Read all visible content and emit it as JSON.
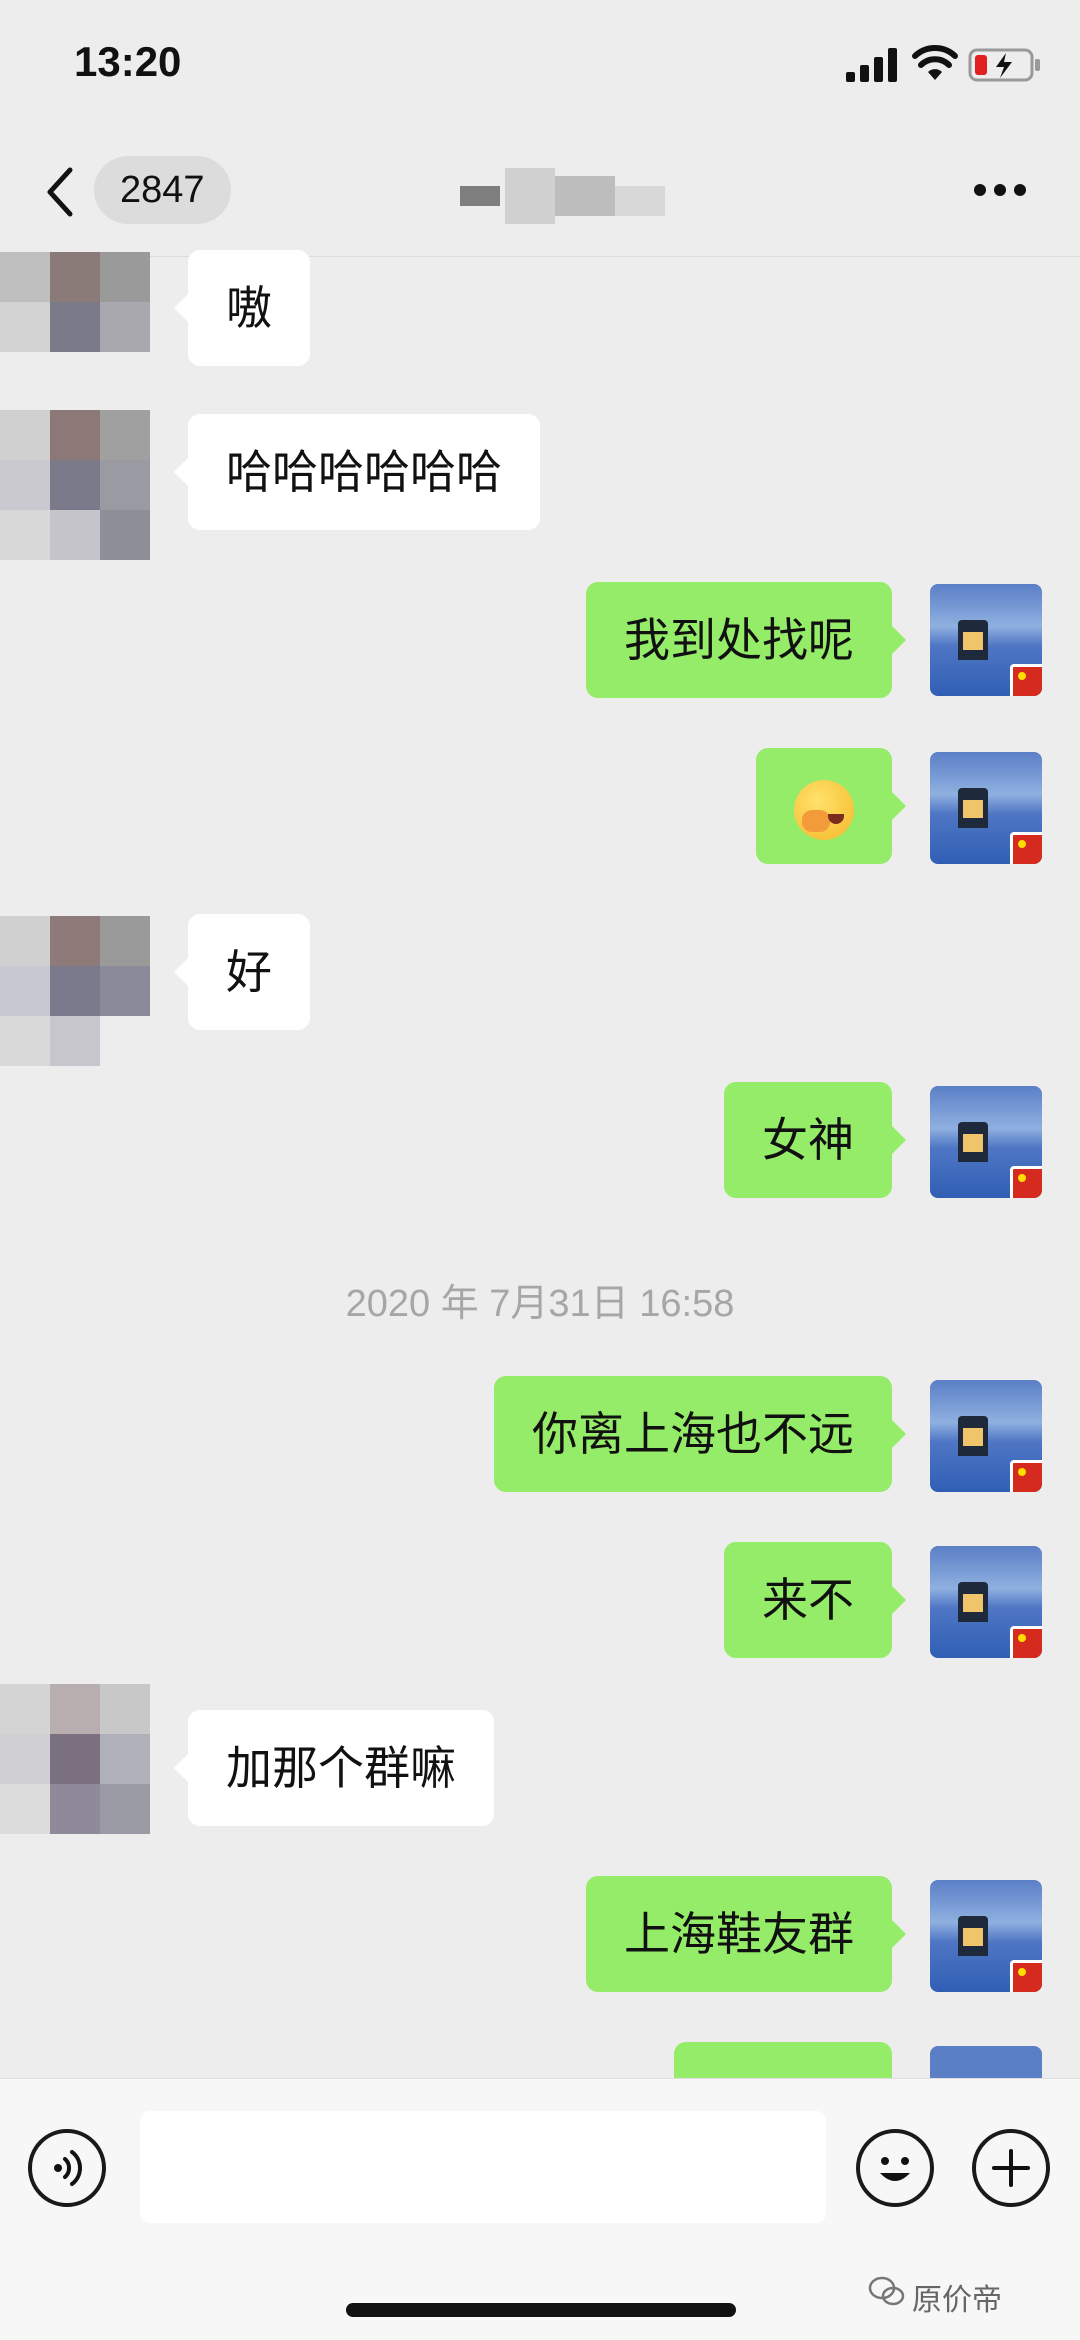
{
  "status_bar": {
    "time": "13:20"
  },
  "nav": {
    "unread_count": "2847"
  },
  "messages": [
    {
      "side": "left",
      "text": "嗷"
    },
    {
      "side": "left",
      "text": "哈哈哈哈哈哈"
    },
    {
      "side": "right",
      "text": "我到处找呢"
    },
    {
      "side": "right",
      "text": "",
      "emoji": "face-palm-emoji"
    },
    {
      "side": "left",
      "text": "好"
    },
    {
      "side": "right",
      "text": "女神"
    },
    {
      "side": "right",
      "text": "你离上海也不远"
    },
    {
      "side": "right",
      "text": "来不"
    },
    {
      "side": "left",
      "text": "加那个群嘛"
    },
    {
      "side": "right",
      "text": "上海鞋友群"
    }
  ],
  "timestamp": "2020 年 7月31日 16:58",
  "input": {
    "value": "",
    "placeholder": ""
  },
  "watermark": "原价帝",
  "colors": {
    "background": "#ededed",
    "self_bubble": "#95ec69",
    "other_bubble": "#ffffff"
  }
}
